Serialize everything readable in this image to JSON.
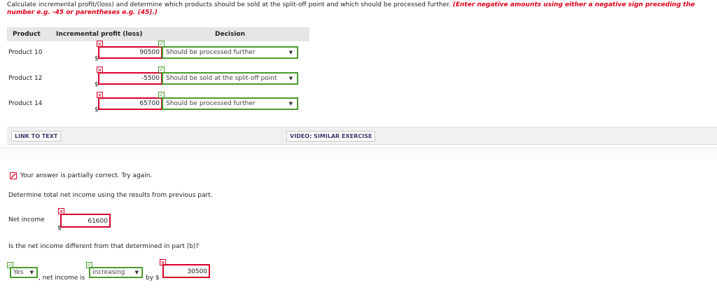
{
  "instructions": {
    "text": "Calculate incremental profit/(loss) and determine which products should be sold at the split-off point and which should be processed further.",
    "red_text": "(Enter negative amounts using either a negative sign preceding the number e.g. -45 or parentheses e.g. (45).)"
  },
  "table": {
    "headers": [
      "Product",
      "Incremental profit (loss)",
      "Decision"
    ],
    "rows": [
      {
        "product": "Product 10",
        "currency": "$",
        "profit": "90500",
        "decision": "Should be processed further"
      },
      {
        "product": "Product 12",
        "currency": "$",
        "profit": "-5500",
        "decision": "Should be sold at the split-off point"
      },
      {
        "product": "Product 14",
        "currency": "$",
        "profit": "65700",
        "decision": "Should be processed further"
      }
    ]
  },
  "links": {
    "link_to_text": "LINK TO TEXT",
    "video": "VIDEO: SIMILAR EXERCISE"
  },
  "feedback": {
    "status": "Your answer is partially correct.  Try again."
  },
  "part2": {
    "question": "Determine total net income using the results from previous part.",
    "net_income_label": "Net income",
    "currency": "$",
    "net_income_value": "61600",
    "question2": "Is the net income different from that determined in part (b)?",
    "answer_select": "Yes",
    "mid_text": ", net income is",
    "direction_select": "increasing",
    "by_text": "by",
    "by_currency": "$",
    "by_value": "30500"
  },
  "colors": {
    "error_red": "#d9002a",
    "correct_green": "#4b9b2c",
    "instruction_red": "#e0001b"
  },
  "icons": {
    "incorrect": "x-mark-icon",
    "correct": "check-mark-icon",
    "dropdown": "triangle-down-icon"
  }
}
